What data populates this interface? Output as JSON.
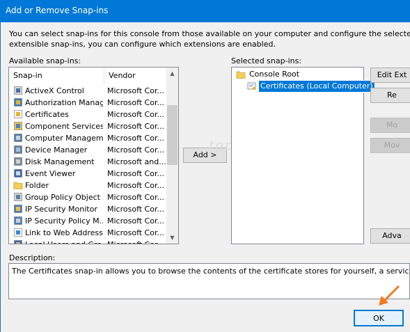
{
  "window": {
    "title": "Add or Remove Snap-ins"
  },
  "intro": {
    "line1": "You can select snap-ins for this console from those available on your computer and configure the selected set of snap-in",
    "line2": "extensible snap-ins, you can configure which extensions are enabled."
  },
  "available": {
    "label": "Available snap-ins:",
    "col_snapin": "Snap-in",
    "col_vendor": "Vendor",
    "items": [
      {
        "name": "ActiveX Control",
        "vendor": "Microsoft Cor...",
        "icon": "activex-icon"
      },
      {
        "name": "Authorization Manager",
        "vendor": "Microsoft Cor...",
        "icon": "authorization-icon"
      },
      {
        "name": "Certificates",
        "vendor": "Microsoft Cor...",
        "icon": "certificate-icon"
      },
      {
        "name": "Component Services",
        "vendor": "Microsoft Cor...",
        "icon": "component-services-icon"
      },
      {
        "name": "Computer Managem",
        "vendor": "Microsoft Cor...",
        "icon": "computer-management-icon"
      },
      {
        "name": "Device Manager",
        "vendor": "Microsoft Cor...",
        "icon": "device-manager-icon"
      },
      {
        "name": "Disk Management",
        "vendor": "Microsoft and...",
        "icon": "disk-management-icon"
      },
      {
        "name": "Event Viewer",
        "vendor": "Microsoft Cor...",
        "icon": "event-viewer-icon"
      },
      {
        "name": "Folder",
        "vendor": "Microsoft Cor...",
        "icon": "folder-icon"
      },
      {
        "name": "Group Policy Object ...",
        "vendor": "Microsoft Cor...",
        "icon": "group-policy-icon"
      },
      {
        "name": "IP Security Monitor",
        "vendor": "Microsoft Cor...",
        "icon": "ip-security-monitor-icon"
      },
      {
        "name": "IP Security Policy M...",
        "vendor": "Microsoft Cor...",
        "icon": "ip-security-policy-icon"
      },
      {
        "name": "Link to Web Address",
        "vendor": "Microsoft Cor...",
        "icon": "web-link-icon"
      },
      {
        "name": "Local Users and Gro...",
        "vendor": "Microsoft Cor...",
        "icon": "local-users-icon"
      }
    ]
  },
  "add_button": "Add >",
  "selected": {
    "label": "Selected snap-ins:",
    "root": "Console Root",
    "child": "Certificates (Local Computer)"
  },
  "side_buttons": {
    "edit_extensions": "Edit Ext",
    "remove": "Re",
    "move_up": "Mo",
    "move_down": "Mov",
    "advanced": "Adva"
  },
  "description": {
    "label": "Description:",
    "text": "The Certificates snap-in allows you to browse the contents of the certificate stores for yourself, a service, or a comput"
  },
  "ok_button": "OK",
  "watermark": "top-password.com",
  "colors": {
    "titlebar": "#0078d7",
    "selection": "#0078d7",
    "annotation_arrow": "#f07a1e"
  }
}
